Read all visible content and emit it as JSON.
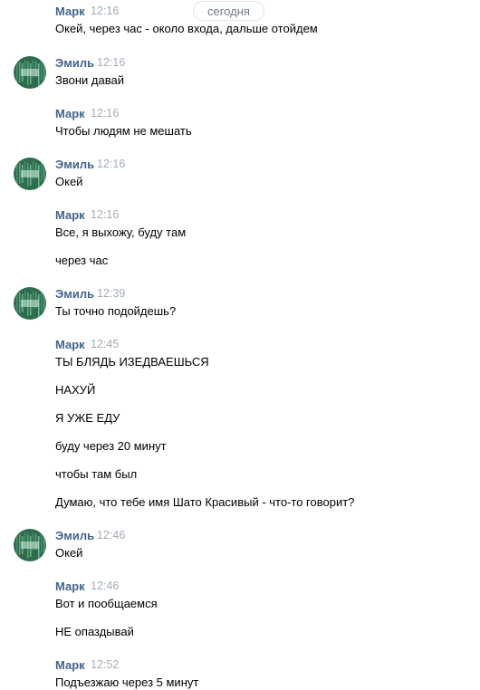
{
  "date_divider": "сегодня",
  "groups": [
    {
      "author": "Марк",
      "time": "12:16",
      "avatar": false,
      "messages": [
        "Окей, через час - около входа, дальше отойдем"
      ]
    },
    {
      "author": "Эмиль",
      "time": "12:16",
      "avatar": true,
      "messages": [
        "Звони давай"
      ]
    },
    {
      "author": "Марк",
      "time": "12:16",
      "avatar": false,
      "messages": [
        "Чтобы людям не мешать"
      ]
    },
    {
      "author": "Эмиль",
      "time": "12:16",
      "avatar": true,
      "messages": [
        "Окей"
      ]
    },
    {
      "author": "Марк",
      "time": "12:16",
      "avatar": false,
      "messages": [
        "Все, я выхожу, буду там",
        "через час"
      ]
    },
    {
      "author": "Эмиль",
      "time": "12:39",
      "avatar": true,
      "messages": [
        "Ты точно подойдешь?"
      ]
    },
    {
      "author": "Марк",
      "time": "12:45",
      "avatar": false,
      "messages": [
        "ТЫ БЛЯДЬ ИЗЕДВАЕШЬСЯ",
        "НАХУЙ",
        "Я УЖЕ ЕДУ",
        "буду через 20 минут",
        "чтобы там был",
        "Думаю, что тебе имя Шато Красивый - что-то говорит?"
      ]
    },
    {
      "author": "Эмиль",
      "time": "12:46",
      "avatar": true,
      "messages": [
        "Окей"
      ]
    },
    {
      "author": "Марк",
      "time": "12:46",
      "avatar": false,
      "messages": [
        "Вот и пообщаемся",
        "НЕ опаздывай"
      ]
    },
    {
      "author": "Марк",
      "time": "12:52",
      "avatar": false,
      "messages": [
        "Подъезжаю через 5 минут"
      ]
    }
  ],
  "colors": {
    "author": "#42648b",
    "time": "#a3acb6",
    "text": "#000000",
    "avatar_bg": "#2f6b4f",
    "avatar_accent": "#7fd0a0"
  }
}
